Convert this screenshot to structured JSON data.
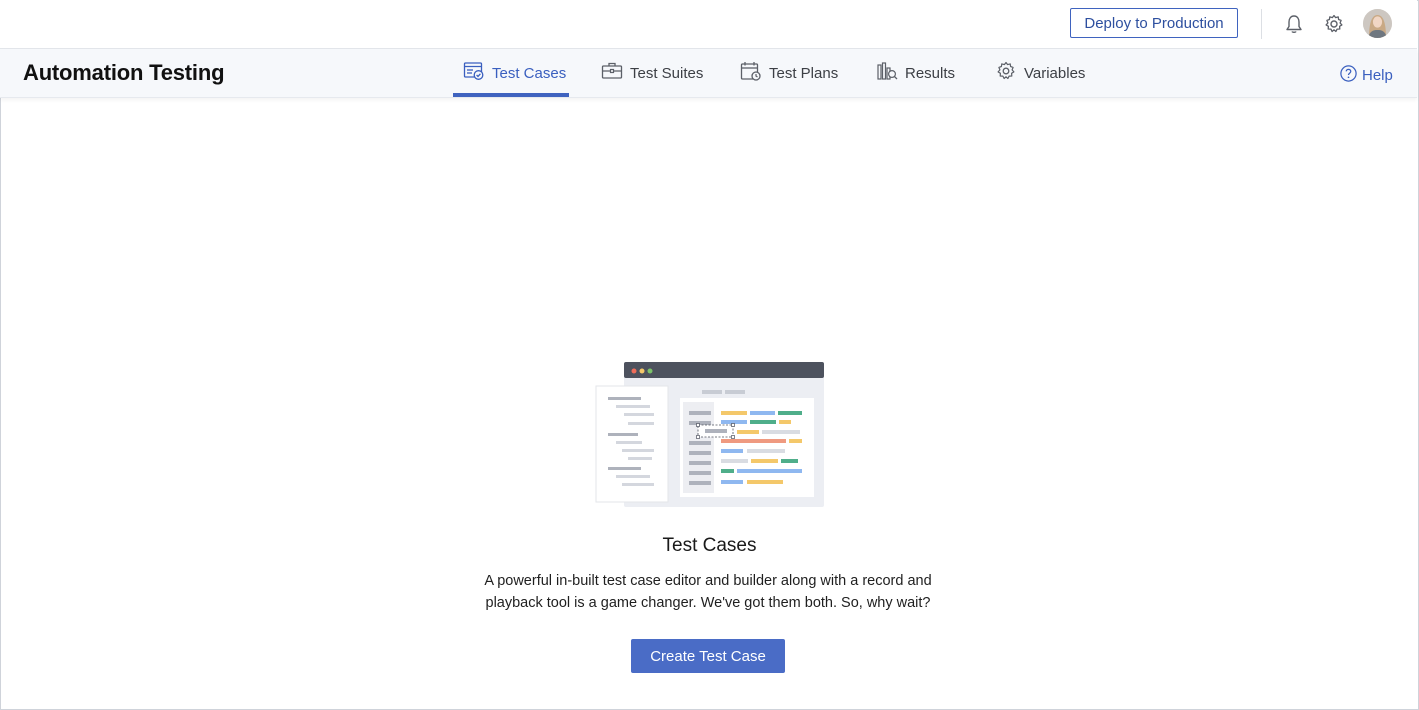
{
  "header": {
    "deploy_label": "Deploy to Production",
    "icons": [
      "bell-icon",
      "gear-icon",
      "avatar"
    ]
  },
  "nav": {
    "app_title": "Automation Testing",
    "tabs": [
      {
        "label": "Test Cases",
        "icon": "test-cases-icon",
        "active": true
      },
      {
        "label": "Test Suites",
        "icon": "briefcase-icon",
        "active": false
      },
      {
        "label": "Test Plans",
        "icon": "calendar-icon",
        "active": false
      },
      {
        "label": "Results",
        "icon": "results-icon",
        "active": false
      },
      {
        "label": "Variables",
        "icon": "gear-icon",
        "active": false
      }
    ],
    "help_label": "Help"
  },
  "empty_state": {
    "title": "Test Cases",
    "description": "A powerful in-built test case editor and builder along with a record and playback tool is a game changer. We've got them both. So, why wait?",
    "button_label": "Create Test Case"
  },
  "colors": {
    "accent": "#3f63bf",
    "button": "#4a6cc6",
    "window_bar": "#4d525e",
    "illustration_yellow": "#f4c86a",
    "illustration_blue": "#8fb8f0",
    "illustration_green": "#4fae8a",
    "illustration_red": "#ef9a80"
  }
}
